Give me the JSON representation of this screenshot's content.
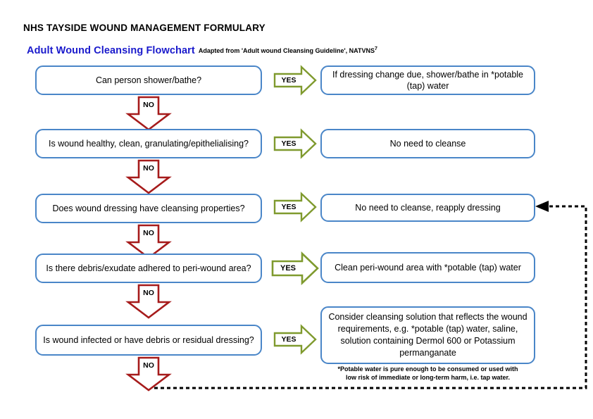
{
  "document": {
    "formulary_title": "NHS TAYSIDE WOUND MANAGEMENT FORMULARY",
    "flowchart_title": "Adult Wound Cleansing Flowchart",
    "adapted_from": "Adapted from 'Adult wound Cleansing Guideline', NATVNS",
    "adapted_superscript": "7"
  },
  "colors": {
    "box_border": "#4a86c8",
    "no_arrow": "#a61b1b",
    "yes_arrow": "#7f9a2e",
    "heading_blue": "#1a1acc",
    "dashed_line": "#000000"
  },
  "flow": {
    "rows": [
      {
        "question": "Can person shower/bathe?",
        "yes_label": "YES",
        "outcome": "If dressing change due, shower/bathe in *potable (tap) water",
        "no_label": "NO"
      },
      {
        "question": "Is wound healthy, clean, granulating/epithelialising?",
        "yes_label": "YES",
        "outcome": "No need to cleanse",
        "no_label": "NO"
      },
      {
        "question": "Does wound dressing have cleansing properties?",
        "yes_label": "YES",
        "outcome": "No need to cleanse, reapply dressing",
        "no_label": "NO"
      },
      {
        "question": "Is there debris/exudate adhered to peri-wound area?",
        "yes_label": "YES",
        "outcome": "Clean peri-wound area with *potable (tap) water",
        "no_label": "NO"
      },
      {
        "question": "Is wound infected or have debris or residual dressing?",
        "yes_label": "YES",
        "outcome": "Consider cleansing solution that reflects the wound requirements, e.g. *potable (tap) water, saline, solution containing Dermol 600 or Potassium permanganate",
        "no_label": "NO"
      }
    ],
    "final_no_label": "NO"
  },
  "footnote": {
    "line1": "*Potable water is pure enough to be consumed or used with",
    "line2": "low risk of immediate or long-term harm, i.e. tap water."
  }
}
